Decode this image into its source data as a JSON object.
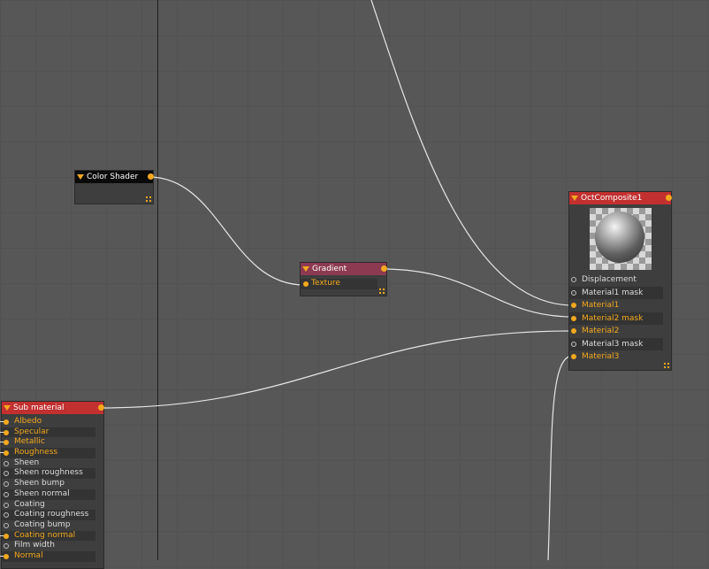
{
  "colors": {
    "accent": "#f3a81d",
    "node_red": "#c23030",
    "gradient_header": "#8c3a52",
    "wire": "#e6e6e6"
  },
  "nodes": {
    "color_shader": {
      "title": "Color Shader"
    },
    "gradient": {
      "title": "Gradient",
      "pins": [
        {
          "label": "Texture",
          "connected": true
        }
      ]
    },
    "oct_composite": {
      "title": "OctComposite1",
      "pins": [
        {
          "label": "Displacement",
          "connected": false
        },
        {
          "label": "Material1 mask",
          "connected": false
        },
        {
          "label": "Material1",
          "connected": true
        },
        {
          "label": "Material2 mask",
          "connected": true
        },
        {
          "label": "Material2",
          "connected": true
        },
        {
          "label": "Material3 mask",
          "connected": false
        },
        {
          "label": "Material3",
          "connected": true
        }
      ]
    },
    "sub_material": {
      "title": "Sub material",
      "pins": [
        {
          "label": "Albedo",
          "connected": true
        },
        {
          "label": "Specular",
          "connected": true
        },
        {
          "label": "Metallic",
          "connected": true
        },
        {
          "label": "Roughness",
          "connected": true
        },
        {
          "label": "Sheen",
          "connected": false
        },
        {
          "label": "Sheen roughness",
          "connected": false
        },
        {
          "label": "Sheen bump",
          "connected": false
        },
        {
          "label": "Sheen normal",
          "connected": false
        },
        {
          "label": "Coating",
          "connected": false
        },
        {
          "label": "Coating roughness",
          "connected": false
        },
        {
          "label": "Coating bump",
          "connected": false
        },
        {
          "label": "Coating normal",
          "connected": true
        },
        {
          "label": "Film width",
          "connected": false
        },
        {
          "label": "Normal",
          "connected": true
        }
      ]
    }
  }
}
